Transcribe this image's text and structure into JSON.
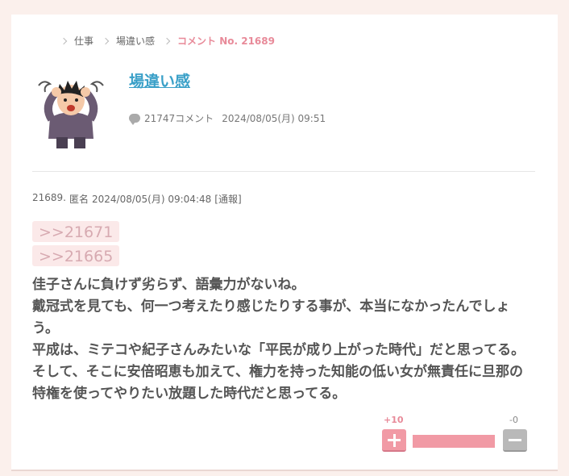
{
  "breadcrumb": [
    {
      "label": "仕事"
    },
    {
      "label": "場違い感"
    },
    {
      "label": "コメント No. 21689"
    }
  ],
  "thread": {
    "title": "場違い感",
    "comment_count": "21747コメント",
    "date": "2024/08/05(月) 09:51"
  },
  "comment": {
    "number": "21689.",
    "author": "匿名",
    "datetime": "2024/08/05(月) 09:04:48",
    "report_label": "[通報]",
    "anchors": [
      ">>21671",
      ">>21665"
    ],
    "lines": [
      "佳子さんに負けず劣らず、語彙力がないね。",
      "戴冠式を見ても、何一つ考えたり感じたりする事が、本当になかったんでしょう。",
      "平成は、ミテコや紀子さんみたいな「平民が成り上がった時代」だと思ってる。そして、そこに安倍昭恵も加えて、権力を持った知能の低い女が無責任に旦那の特権を使ってやりたい放題した時代だと思ってる。"
    ]
  },
  "votes": {
    "plus_label": "+10",
    "minus_label": "-0",
    "plus_fraction": 1.0
  },
  "colors": {
    "accent_pink": "#e88a99",
    "title_blue": "#3aa0c8",
    "background": "#fbf0ec"
  }
}
